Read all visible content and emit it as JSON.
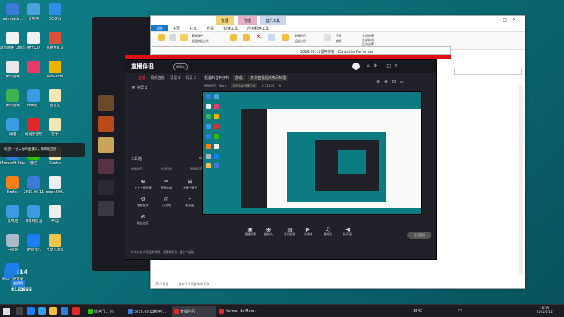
{
  "desktop": {
    "icons": [
      {
        "label": "Administr...",
        "color": "#3a7bd5"
      },
      {
        "label": "此电脑",
        "color": "#4aa3df"
      },
      {
        "label": "QQ游戏",
        "color": "#2e8de6"
      },
      {
        "label": "反恐精英 Online",
        "color": "#f2f2f2"
      },
      {
        "label": "腾讯QQ",
        "color": "#f0f0f0"
      },
      {
        "label": "英雄大乱斗",
        "color": "#d94f3a"
      },
      {
        "label": "腾讯游戏",
        "color": "#e8e8e8"
      },
      {
        "label": "",
        "color": "#e83a6b"
      },
      {
        "label": "WeGame",
        "color": "#f0b400"
      },
      {
        "label": "腾讯游戏",
        "color": "#3fb34f"
      },
      {
        "label": "九幽暗...",
        "color": "#3a9be0"
      },
      {
        "label": "合盟区",
        "color": "#f3e6b0"
      },
      {
        "label": "网络",
        "color": "#3a9be0"
      },
      {
        "label": "网易云音乐",
        "color": "#e02a2a"
      },
      {
        "label": "音乐",
        "color": "#f3e6b0"
      },
      {
        "label": "Microsoft Edge",
        "color": "#2c7fd6"
      },
      {
        "label": "微信",
        "color": "#2dc100"
      },
      {
        "label": "Cache",
        "color": "#f3e6b0"
      },
      {
        "label": "Firefox",
        "color": "#ff7f1a"
      },
      {
        "label": "2019.06.11",
        "color": "#3a7bd5"
      },
      {
        "label": "recon8001",
        "color": "#eeeeee"
      },
      {
        "label": "此电脑",
        "color": "#3a9be0"
      },
      {
        "label": "QQ浏览器",
        "color": "#3a9be0"
      },
      {
        "label": "神器",
        "color": "#eeeeee"
      },
      {
        "label": "回收站",
        "color": "#aab8c8"
      },
      {
        "label": "酷狗音乐",
        "color": "#1b7df2"
      },
      {
        "label": "开发小游戏",
        "color": "#f3c24a"
      },
      {
        "label": "腾讯电脑管家",
        "color": "#1b7df2"
      }
    ]
  },
  "explorer": {
    "context_tabs": [
      "管理",
      "管理",
      "音乐工具"
    ],
    "tabs": [
      "文件",
      "主页",
      "共享",
      "查看",
      "快速工具",
      "应用程序工具"
    ],
    "ribbon_items": [
      "复制路径",
      "粘贴快捷方式",
      "移动到",
      "复制到",
      "删除",
      "重命名",
      "新建项目",
      "轻松访问",
      "新建文件夹",
      "属性",
      "打开",
      "编辑",
      "历史记录",
      "全部选择",
      "全部取消",
      "反向选择"
    ],
    "status_left": "22 个项目",
    "status_mid": "选中 1 个项目  960 千字"
  },
  "cantabile": {
    "title": "2019.06.11唱吧伴奏 - Cantabile Performer"
  },
  "live": {
    "app_name": "直播伴侣",
    "badge": "新版本",
    "side_tabs": [
      "直播",
      "视频直播",
      "场景 1",
      "场景 2"
    ],
    "scene_label": "全屏 1",
    "room_title": "我是的音神仔的",
    "room_tag": "游戏",
    "room_edit_hint": "开启直播后的房间标题",
    "sub_label": "直播标签：未输入",
    "sub_category": "开启你的直播飞快",
    "room_id": "8152555",
    "room_count": "0",
    "tools_header": "工具箱",
    "tools_row": [
      "数据助手",
      "全民乐园",
      "直播设置"
    ],
    "tools": [
      {
        "glyph": "⊕",
        "label": "上个一键开播"
      },
      {
        "glyph": "✂",
        "label": "直播剪辑"
      },
      {
        "glyph": "⊞",
        "label": "主播一键开"
      },
      {
        "glyph": "⚙",
        "label": "发起投票"
      },
      {
        "glyph": "◎",
        "label": "小游戏"
      },
      {
        "glyph": "✧",
        "label": "粉丝团"
      },
      {
        "glyph": "⊛",
        "label": "粉丝连接"
      }
    ],
    "controls": [
      {
        "glyph": "▣",
        "label": "直播屏幕"
      },
      {
        "glyph": "◉",
        "label": "摄像头"
      },
      {
        "glyph": "▤",
        "label": "手机投屏"
      },
      {
        "glyph": "▶",
        "label": "多媒体"
      },
      {
        "glyph": "♫",
        "label": "麦克风"
      },
      {
        "glyph": "◀",
        "label": "扬声器"
      }
    ],
    "go_live_label": "开始直播",
    "bottom_text": "0 条公告  你还没有开播，直播标签为 : 登上一层楼"
  },
  "greeting": {
    "prefix": "欢迎",
    "name": "***",
    "suffix": "进入你的直播间，快来欢迎他"
  },
  "brand": {
    "short": "i14",
    "label": "房间号",
    "room": "8152555"
  },
  "taskbar": {
    "tasks": [
      {
        "label": "微信门...(9)",
        "color": "#2dc100",
        "active": false
      },
      {
        "label": "2019.06.11唱吧/...",
        "color": "#3a7bd5",
        "active": false
      },
      {
        "label": "直播伴侣",
        "color": "#e02a2a",
        "active": true
      },
      {
        "label": "Normal No More...",
        "color": "#e02a2a",
        "active": false
      }
    ],
    "tray_temp": "15°C",
    "tray_lang": "中",
    "time": "18:56",
    "date": "2022/5/12"
  },
  "colors": {
    "desktop_teal": "#0c7b82",
    "accent_red": "#dd1111",
    "taskbar": "#1c1c22"
  }
}
